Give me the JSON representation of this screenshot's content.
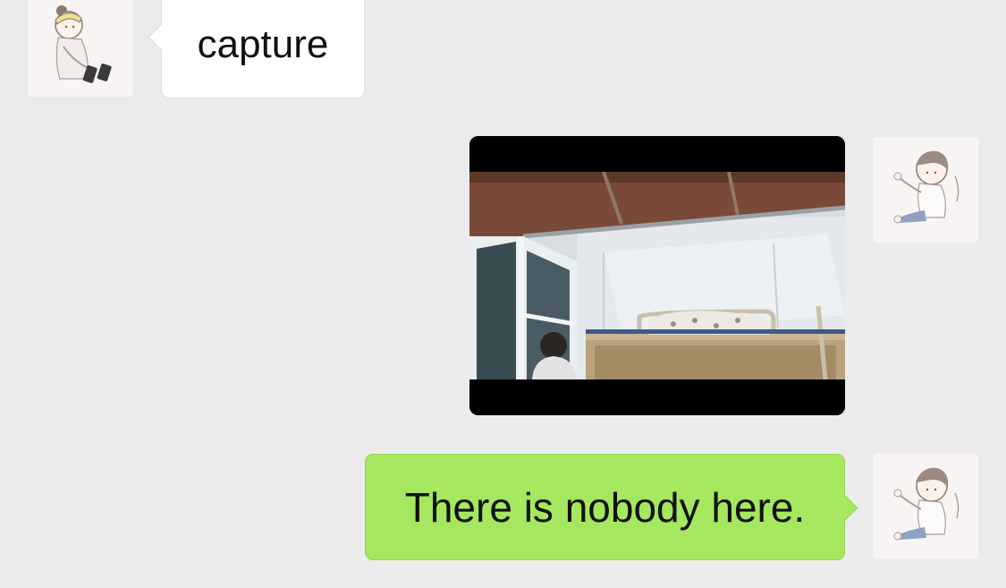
{
  "messages": [
    {
      "sender": "other",
      "type": "text",
      "text": "capture"
    },
    {
      "sender": "me",
      "type": "video",
      "icon": "video-thumbnail"
    },
    {
      "sender": "me",
      "type": "text",
      "text": "There is nobody here."
    }
  ],
  "colors": {
    "background": "#ebebeb",
    "incoming_bubble": "#ffffff",
    "outgoing_bubble": "#a5e85f"
  }
}
